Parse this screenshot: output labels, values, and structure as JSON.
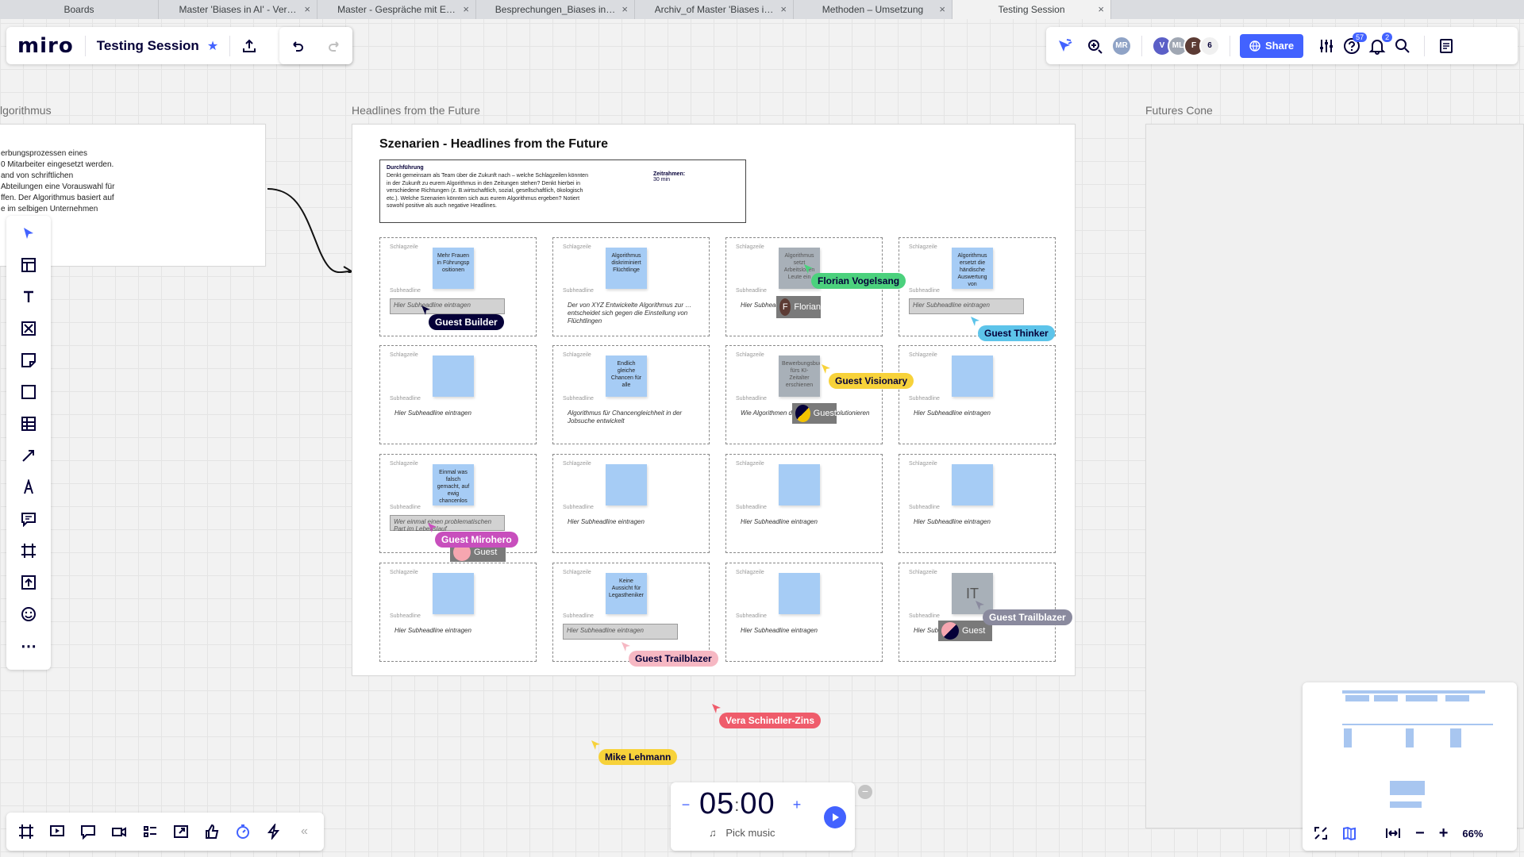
{
  "browser_tabs": [
    {
      "label": "Boards",
      "active": false
    },
    {
      "label": "Master 'Biases in AI' - Ver…",
      "active": false
    },
    {
      "label": "Master - Gespräche mit E…",
      "active": false
    },
    {
      "label": "Besprechungen_Biases in…",
      "active": false
    },
    {
      "label": "Archiv_of Master 'Biases i…",
      "active": false
    },
    {
      "label": "Methoden – Umsetzung",
      "active": false
    },
    {
      "label": "Testing Session",
      "active": true
    }
  ],
  "toolbar": {
    "logo": "miro",
    "board_title": "Testing Session",
    "share_label": "Share",
    "participants_count": "6",
    "help_badge": "57",
    "notif_badge": "2",
    "avatars": [
      {
        "initials": "MR",
        "color": "#8fa3c6"
      },
      {
        "initials": "V",
        "color": "#5b5fc7"
      },
      {
        "initials": "ML",
        "color": "#a0a7b3"
      },
      {
        "initials": "F",
        "color": "#5c3b34"
      }
    ]
  },
  "frames": {
    "left_label": "lgorithmus",
    "left_text": "erbungsprozessen eines\n0 Mitarbeiter eingesetzt werden.\nand von schriftlichen\nAbteilungen eine Vorauswahl für\nffen. Der Algorithmus basiert auf\ne im selbigen Unternehmen",
    "main_label": "Headlines from the Future",
    "futures_label": "Futures Cone"
  },
  "main_frame": {
    "title": "Szenarien - Headlines from the Future",
    "instructions_head": "Durchführung",
    "instructions_body": "Denkt gemeinsam als Team über die Zukunft nach – welche Schlagzeilen könnten in der Zukunft zu eurem Algorithmus in den Zeitungen stehen? Denkt hierbei in verschiedene Richtungen (z. B.wirtschaftlich, sozial, gesellschaftlich, ökologisch etc.). Welche Szenarien könnten sich aus eurem Algorithmus ergeben? Notiert sowohl positive als auch negative Headlines.",
    "time_label": "Zeitrahmen:",
    "time_value": "30 min",
    "tag_headline": "Schlagzeile",
    "tag_sub": "Subheadline",
    "cells": [
      {
        "sticky": "Mehr Frauen in Führungsp ositionen",
        "sub": "Hier Subheadline eintragen",
        "sub_box": true,
        "grey": false
      },
      {
        "sticky": "Algorithmus diskriminiert Flüchtlinge",
        "sub": "Der von XYZ Entwickelte Algorithmus zur … entscheidet sich gegen die Einstellung von Flüchtlingen",
        "sub_box": false,
        "grey": false
      },
      {
        "sticky": "Algorithmus setzt Arbeitslosen Leute ein",
        "sub": "Hier Subheadline eintragen",
        "sub_box": false,
        "grey": true
      },
      {
        "sticky": "Algorithmus ersetzt die händische Auswertung von Bewerbungen",
        "sub": "Hier Subheadline eintragen",
        "sub_box": true,
        "grey": false
      },
      {
        "sticky": "",
        "sub": "Hier Subheadline eintragen",
        "sub_box": false,
        "grey": false
      },
      {
        "sticky": "Endlich gleiche Chancen für alle",
        "sub": "Algorithmus für Chancengleichheit in der Jobsuche entwickelt",
        "sub_box": false,
        "grey": false
      },
      {
        "sticky": "Bewerbungsbuch fürs KI-Zeitalter erschienen",
        "sub": "Wie Algorithmen die Jobsuche revolutionieren",
        "sub_box": false,
        "grey": true
      },
      {
        "sticky": "",
        "sub": "Hier Subheadline eintragen",
        "sub_box": false,
        "grey": false
      },
      {
        "sticky": "Einmal was falsch gemacht, auf ewig chancenlos",
        "sub": "Wer einmal einen problematischen Part im Lebenslauf",
        "sub_box": true,
        "grey": false
      },
      {
        "sticky": "",
        "sub": "Hier Subheadline eintragen",
        "sub_box": false,
        "grey": false
      },
      {
        "sticky": "",
        "sub": "Hier Subheadline eintragen",
        "sub_box": false,
        "grey": false
      },
      {
        "sticky": "",
        "sub": "Hier Subheadline eintragen",
        "sub_box": false,
        "grey": false
      },
      {
        "sticky": "",
        "sub": "Hier Subheadline eintragen",
        "sub_box": false,
        "grey": false
      },
      {
        "sticky": "Keine Aussicht für Legastheniker",
        "sub": "Hier Subheadline eintragen",
        "sub_box": true,
        "grey": false
      },
      {
        "sticky": "",
        "sub": "Hier Subheadline eintragen",
        "sub_box": false,
        "grey": false
      },
      {
        "sticky": "IT",
        "sub": "Hier Subheadline eintragen",
        "sub_box": false,
        "grey": true
      }
    ]
  },
  "locks": [
    {
      "label": "Florian",
      "initial": "F",
      "color": "#5c3b34"
    },
    {
      "label": "Guest",
      "initial": "",
      "color": "#f3c200"
    },
    {
      "label": "Guest",
      "initial": "",
      "color": "#f6a6b0"
    },
    {
      "label": "Guest",
      "initial": "",
      "color": "#f6a6b0"
    }
  ],
  "cursors": [
    {
      "name": "Guest Builder",
      "bg": "#050038",
      "fg": "#ffffff"
    },
    {
      "name": "Florian Vogelsang",
      "bg": "#4bd17d",
      "fg": "#050038"
    },
    {
      "name": "Guest Thinker",
      "bg": "#5dc4ea",
      "fg": "#050038"
    },
    {
      "name": "Guest Visionary",
      "bg": "#f7d23a",
      "fg": "#050038"
    },
    {
      "name": "Guest Mirohero",
      "bg": "#c84fbd",
      "fg": "#ffffff"
    },
    {
      "name": "Guest Trailblazer",
      "bg": "#f6b8c3",
      "fg": "#050038"
    },
    {
      "name": "Guest Trailblazer",
      "bg": "#8a8a9e",
      "fg": "#ffffff"
    },
    {
      "name": "Vera Schindler-Zins",
      "bg": "#ef5c6b",
      "fg": "#ffffff"
    },
    {
      "name": "Mike Lehmann",
      "bg": "#f7d23a",
      "fg": "#050038"
    }
  ],
  "timer": {
    "minutes": "05",
    "seconds": "00",
    "music_label": "Pick music"
  },
  "zoom": "66%",
  "colors": {
    "accent": "#4262ff",
    "sticky_blue": "#a6ccf5"
  }
}
